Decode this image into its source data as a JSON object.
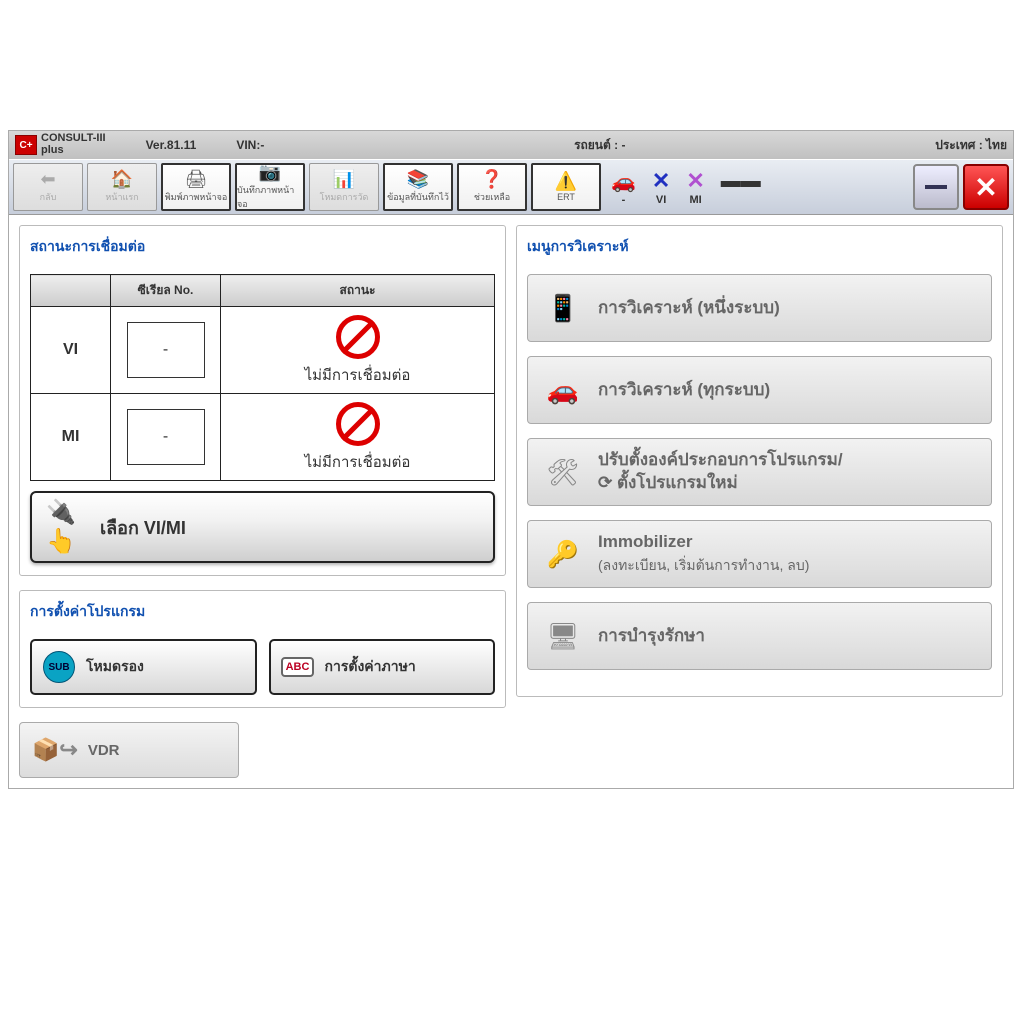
{
  "header": {
    "app_title1": "CONSULT-III",
    "app_title2": "plus",
    "version": "Ver.81.11",
    "vin_label": "VIN:-",
    "vehicle_label": "รถยนต์ : -",
    "country_label": "ประเทศ :  ไทย"
  },
  "toolbar": {
    "back": "กลับ",
    "home": "หน้าแรก",
    "print": "พิมพ์ภาพหน้าจอ",
    "capture": "บันทึกภาพหน้าจอ",
    "mode": "โหมดการวัด",
    "recorded": "ข้อมูลที่บันทึกไว้",
    "help": "ช่วยเหลือ",
    "ert": "ERT"
  },
  "status_icons": {
    "car": "-",
    "vi": "VI",
    "mi": "MI"
  },
  "connection": {
    "title": "สถานะการเชื่อมต่อ",
    "col_blank": "",
    "col_serial": "ซีเรียล No.",
    "col_status": "สถานะ",
    "rows": [
      {
        "label": "VI",
        "serial": "-",
        "status": "ไม่มีการเชื่อมต่อ"
      },
      {
        "label": "MI",
        "serial": "-",
        "status": "ไม่มีการเชื่อมต่อ"
      }
    ],
    "select_btn": "เลือก VI/MI"
  },
  "settings": {
    "title": "การตั้งค่าโปรแกรม",
    "sub_mode": "โหมดรอง",
    "sub_badge": "SUB",
    "language": "การตั้งค่าภาษา",
    "abc_badge": "ABC"
  },
  "vdr": {
    "label": "VDR"
  },
  "diag_menu": {
    "title": "เมนูการวิเคราะห์",
    "items": [
      {
        "label": "การวิเคราะห์ (หนึ่งระบบ)",
        "sub": ""
      },
      {
        "label": "การวิเคราะห์ (ทุกระบบ)",
        "sub": ""
      },
      {
        "label": "ปรับตั้งองค์ประกอบการโปรแกรม/",
        "sub": "ตั้งโปรแกรมใหม่"
      },
      {
        "label": "Immobilizer",
        "sub": "(ลงทะเบียน, เริ่มต้นการทำงาน, ลบ)"
      },
      {
        "label": "การบำรุงรักษา",
        "sub": ""
      }
    ]
  }
}
